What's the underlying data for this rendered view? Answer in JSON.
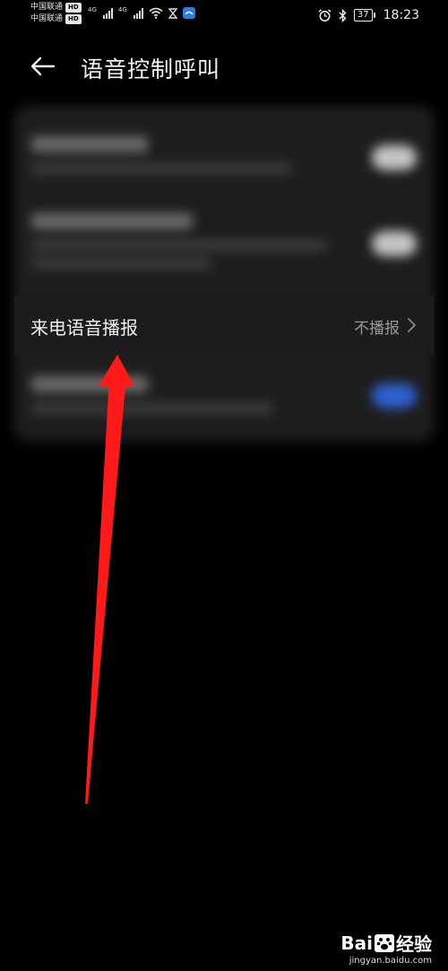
{
  "status_bar": {
    "carrier1": "中国联通",
    "carrier2": "中国联通",
    "hd_badge": "HD",
    "net1": "4G",
    "net2": "4G",
    "battery": "37",
    "time": "18:23"
  },
  "app_bar": {
    "title": "语音控制呼叫"
  },
  "settings": {
    "voice_broadcast": {
      "label": "来电语音播报",
      "value": "不播报"
    }
  },
  "colors": {
    "background": "#000000",
    "card": "#1c1c1c",
    "toggle_on": "#2e5fd0",
    "annotation_arrow": "#ff1a1a"
  },
  "watermark": {
    "logo_left": "Bai",
    "logo_right": "经验",
    "url": "jingyan.baidu.com"
  }
}
